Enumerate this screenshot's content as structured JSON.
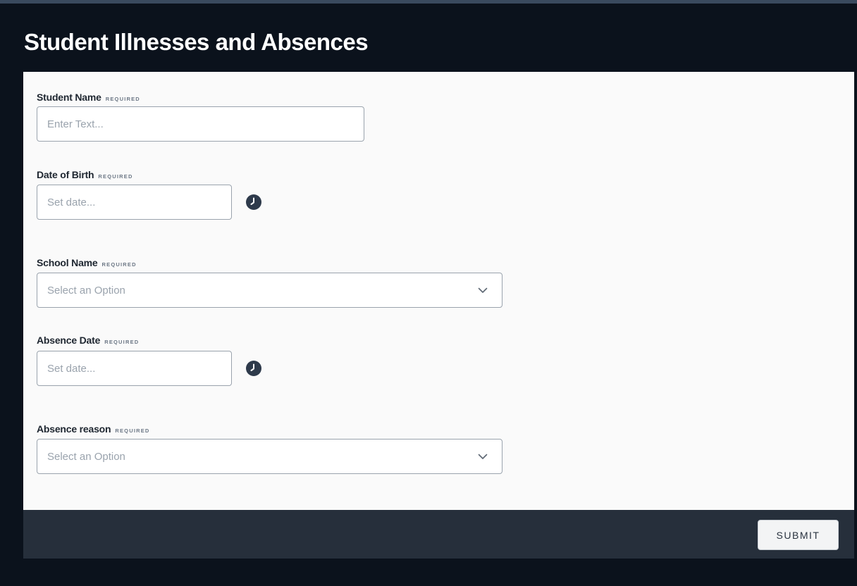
{
  "form": {
    "title": "Student Illnesses and Absences",
    "required_tag": "REQUIRED",
    "student_name": {
      "label": "Student Name",
      "placeholder": "Enter Text...",
      "value": ""
    },
    "date_of_birth": {
      "label": "Date of Birth",
      "placeholder": "Set date...",
      "value": "",
      "icon": "clock-icon"
    },
    "school_name": {
      "label": "School Name",
      "placeholder": "Select an Option",
      "icon": "chevron-down-icon"
    },
    "absence_date": {
      "label": "Absence Date",
      "placeholder": "Set date...",
      "value": "",
      "icon": "clock-icon"
    },
    "absence_reason": {
      "label": "Absence reason",
      "placeholder": "Select an Option",
      "icon": "chevron-down-icon"
    },
    "submit_label": "SUBMIT"
  },
  "colors": {
    "page_background": "#0b121c",
    "form_background": "#fafafa",
    "footer_background": "#262f3b",
    "icon_color": "#2e3a4b",
    "input_border": "#9aa3ad"
  }
}
